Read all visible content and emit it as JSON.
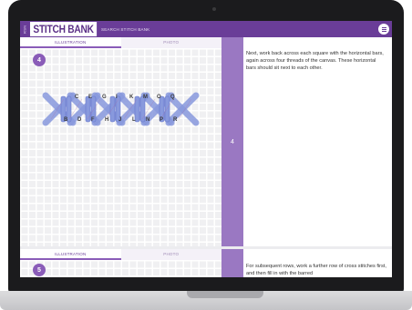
{
  "app": {
    "brand_vertical": "RSN",
    "brand_title": "STITCH BANK",
    "search_label": "SEARCH STITCH BANK",
    "menu_icon": "hamburger-icon"
  },
  "steps": [
    {
      "number": "4",
      "tabs": [
        "ILLUSTRATION",
        "PHOTO"
      ],
      "active_tab": "ILLUSTRATION",
      "side_label": "4",
      "description": "Next, work back across each square with the horizontal bars, again across four threads of the canvas. These horizontal bars should sit next to each other.",
      "top_letters": [
        "C",
        "E",
        "G",
        "I",
        "K",
        "M",
        "O",
        "Q"
      ],
      "bottom_letters": [
        "B",
        "D",
        "F",
        "H",
        "J",
        "L",
        "N",
        "P",
        "R"
      ]
    },
    {
      "number": "5",
      "tabs": [
        "ILLUSTRATION",
        "PHOTO"
      ],
      "active_tab": "ILLUSTRATION",
      "side_label": "",
      "description": "For subsequent rows, work a further row of cross stitches first, and then fill in with the barred"
    }
  ],
  "colors": {
    "header": "#6a3d98",
    "accent": "#8a5cb8",
    "side_strip": "#9a78c2",
    "stitch_fill": "#8899dd",
    "stitch_stroke": "#6677cc"
  }
}
